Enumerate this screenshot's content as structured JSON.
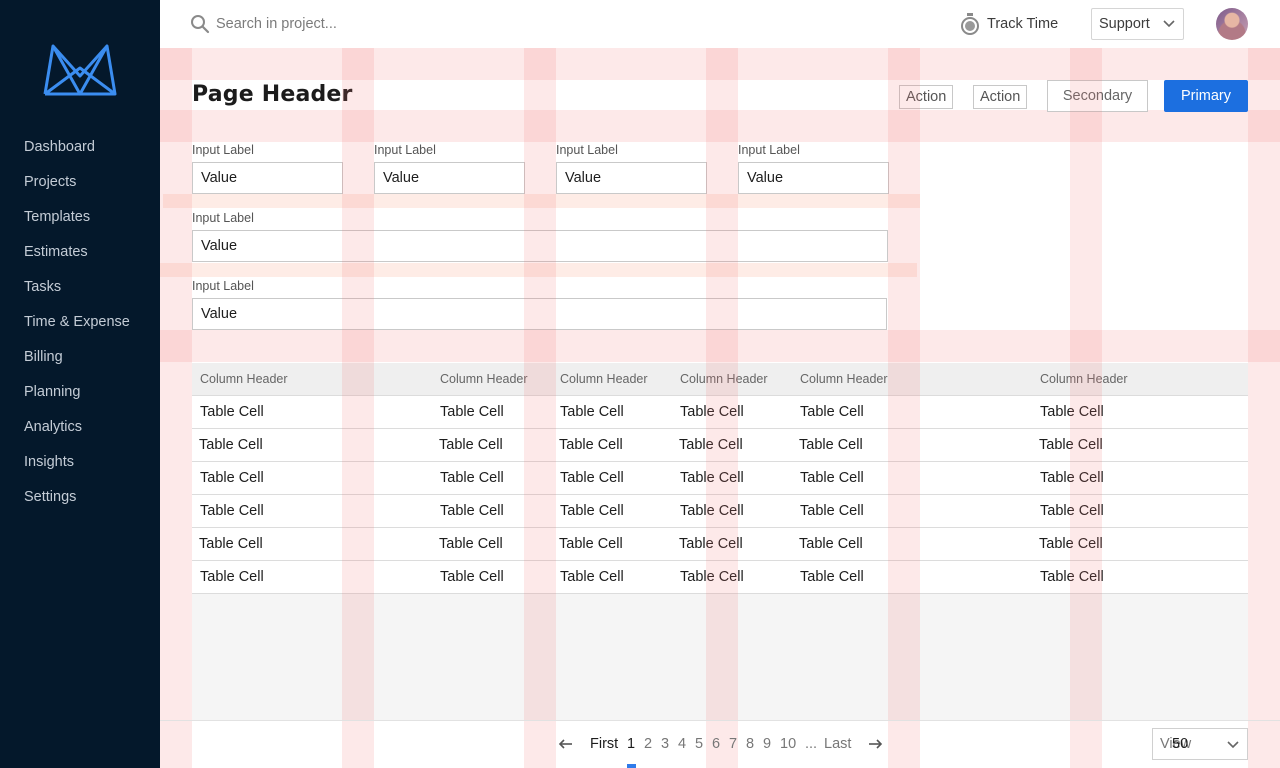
{
  "colors": {
    "sidebar_bg": "#04182b",
    "primary": "#1c6fe0",
    "logo": "#3b8df0",
    "grid_overlay": "rgba(245, 120, 120, 0.22)"
  },
  "sidebar": {
    "logo_icon": "brand-logo-icon",
    "items": [
      {
        "label": "Dashboard"
      },
      {
        "label": "Projects"
      },
      {
        "label": "Templates"
      },
      {
        "label": "Estimates"
      },
      {
        "label": "Tasks"
      },
      {
        "label": "Time & Expense"
      },
      {
        "label": "Billing"
      },
      {
        "label": "Planning"
      },
      {
        "label": "Analytics"
      },
      {
        "label": "Insights"
      },
      {
        "label": "Settings"
      }
    ]
  },
  "topbar": {
    "search_placeholder": "Search in project...",
    "search_icon": "search-icon",
    "track_time_label": "Track Time",
    "track_time_icon": "stopwatch-icon",
    "support_label": "Support",
    "avatar_icon": "user-avatar"
  },
  "header": {
    "title": "Page Header",
    "action1_label": "Action",
    "action2_label": "Action",
    "secondary_label": "Secondary",
    "primary_label": "Primary"
  },
  "form": {
    "row1": [
      {
        "label": "Input Label",
        "value": "Value"
      },
      {
        "label": "Input Label",
        "value": "Value"
      },
      {
        "label": "Input Label",
        "value": "Value"
      },
      {
        "label": "Input Label",
        "value": "Value"
      }
    ],
    "row2": {
      "label": "Input Label",
      "value": "Value"
    },
    "row3": {
      "label": "Input Label",
      "value": "Value"
    }
  },
  "table": {
    "headers": [
      "Column Header",
      "Column Header",
      "Column Header",
      "Column Header",
      "Column Header",
      "Column Header"
    ],
    "rows": [
      [
        "Table Cell",
        "Table Cell",
        "Table Cell",
        "Table Cell",
        "Table Cell",
        "Table Cell"
      ],
      [
        "Table Cell",
        "Table Cell",
        "Table Cell",
        "Table Cell",
        "Table Cell",
        "Table Cell"
      ],
      [
        "Table Cell",
        "Table Cell",
        "Table Cell",
        "Table Cell",
        "Table Cell",
        "Table Cell"
      ],
      [
        "Table Cell",
        "Table Cell",
        "Table Cell",
        "Table Cell",
        "Table Cell",
        "Table Cell"
      ],
      [
        "Table Cell",
        "Table Cell",
        "Table Cell",
        "Table Cell",
        "Table Cell",
        "Table Cell"
      ],
      [
        "Table Cell",
        "Table Cell",
        "Table Cell",
        "Table Cell",
        "Table Cell",
        "Table Cell"
      ]
    ]
  },
  "pagination": {
    "prev_icon": "arrow-left-icon",
    "first": "First",
    "pages": [
      "1",
      "2",
      "3",
      "4",
      "5",
      "6",
      "7",
      "8",
      "9",
      "10"
    ],
    "current": "1",
    "ellipsis": "...",
    "last": "Last",
    "next_icon": "arrow-right-icon",
    "view_label": "View",
    "view_value": "50"
  }
}
